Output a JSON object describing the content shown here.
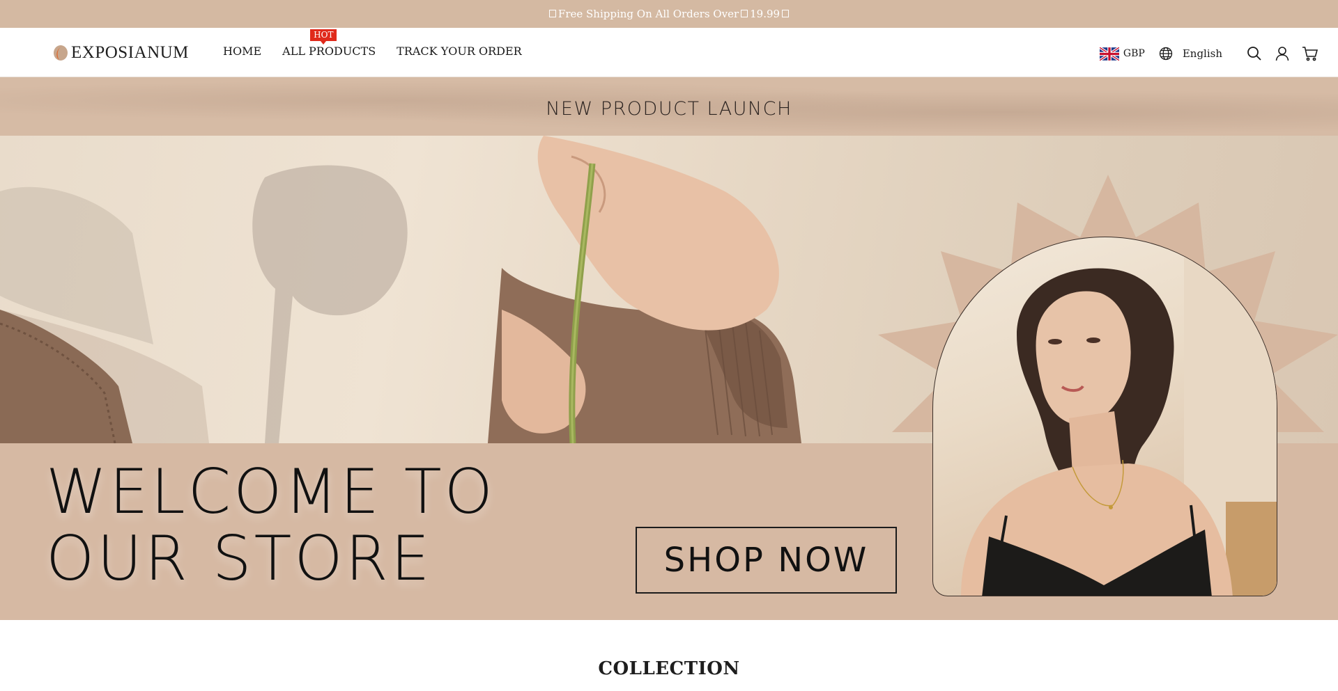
{
  "announcement": {
    "prefix": "",
    "text": "Free Shipping On All Orders Over ",
    "amount": "19.99"
  },
  "header": {
    "logo_text": "EXPOSIANUM",
    "nav": [
      {
        "label": "HOME"
      },
      {
        "label": "ALL PRODUCTS",
        "badge": "HOT"
      },
      {
        "label": "TRACK YOUR ORDER"
      }
    ],
    "currency": "GBP",
    "language": "English",
    "icons": [
      "flag-uk-icon",
      "globe-icon",
      "search-icon",
      "account-icon",
      "cart-icon"
    ]
  },
  "hero": {
    "band_title": "NEW PRODUCT LAUNCH",
    "headline_line1": "WELCOME TO",
    "headline_line2": "OUR STORE",
    "cta_label": "SHOP NOW"
  },
  "collection": {
    "title": "COLLECTION"
  },
  "colors": {
    "announcement_bg": "#d4b9a2",
    "hero_bg": "#d6b9a3",
    "hot_badge": "#e02a1b"
  }
}
